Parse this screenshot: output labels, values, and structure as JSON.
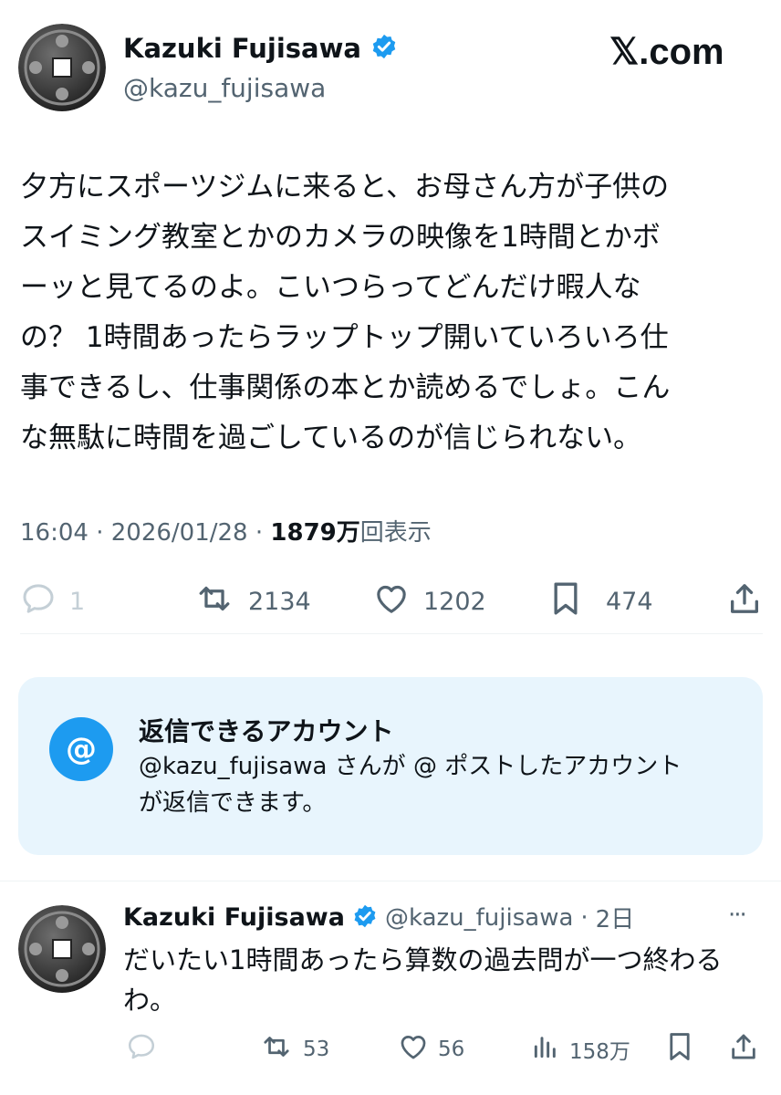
{
  "brand": "𝕏.com",
  "post": {
    "author_name": "Kazuki Fujisawa",
    "author_handle": "@kazu_fujisawa",
    "text_lines": [
      "夕方にスポーツジムに来ると、お母さん方が子供の",
      "スイミング教室とかのカメラの映像を1時間とかボ",
      "ーッと見てるのよ。こいつらってどんだけ暇人な",
      "の？ 1時間あったらラップトップ開いていろいろ仕",
      "事できるし、仕事関係の本とか読めるでしょ。こん",
      "な無駄に時間を過ごしているのが信じられない。"
    ],
    "time": "16:04",
    "date": "2026/01/28",
    "separator": "·",
    "views_count": "1879",
    "views_unit": "万",
    "views_label": "回表示",
    "actions": {
      "replies": "1",
      "reposts": "2134",
      "likes": "1202",
      "bookmarks": "474"
    }
  },
  "reply_notice": {
    "icon": "@",
    "title": "返信できるアカウント",
    "body_line1": "@kazu_fujisawa さんが @ ポストしたアカウント",
    "body_line2": "が返信できます。"
  },
  "reply": {
    "author_name": "Kazuki Fujisawa",
    "author_handle": "@kazu_fujisawa",
    "separator": "·",
    "age": "2日",
    "more": "···",
    "text_lines": [
      "だいたい1時間あったら算数の過去問が一つ終わる",
      "わ。"
    ],
    "actions": {
      "reposts": "53",
      "likes": "56",
      "views": "158万"
    }
  },
  "colors": {
    "text": "#0f1419",
    "secondary": "#536471",
    "verified": "#1d9bf0",
    "notice_bg": "#e8f5fd",
    "divider": "#eff3f4"
  }
}
